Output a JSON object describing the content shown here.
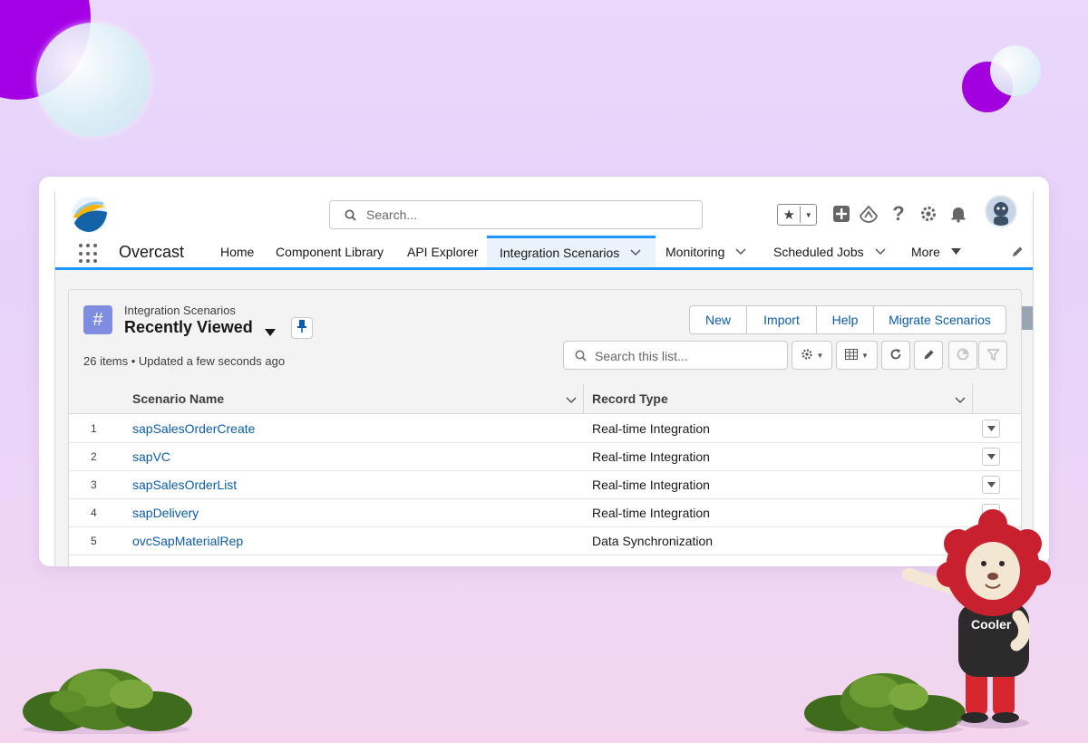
{
  "app": {
    "name": "Overcast",
    "search_placeholder": "Search..."
  },
  "nav": {
    "items": [
      {
        "label": "Home"
      },
      {
        "label": "Component Library"
      },
      {
        "label": "API Explorer"
      },
      {
        "label": "Integration Scenarios",
        "active": true
      },
      {
        "label": "Monitoring"
      },
      {
        "label": "Scheduled Jobs"
      },
      {
        "label": "More"
      }
    ]
  },
  "list_view": {
    "object_label": "Integration Scenarios",
    "view_name": "Recently Viewed",
    "meta": "26 items • Updated a few seconds ago",
    "buttons": [
      "New",
      "Import",
      "Help",
      "Migrate Scenarios"
    ],
    "search_placeholder": "Search this list...",
    "columns": [
      "Scenario Name",
      "Record Type"
    ],
    "rows": [
      {
        "num": "1",
        "name": "sapSalesOrderCreate",
        "type": "Real-time Integration"
      },
      {
        "num": "2",
        "name": "sapVC",
        "type": "Real-time Integration"
      },
      {
        "num": "3",
        "name": "sapSalesOrderList",
        "type": "Real-time Integration"
      },
      {
        "num": "4",
        "name": "sapDelivery",
        "type": "Real-time Integration"
      },
      {
        "num": "5",
        "name": "ovcSapMaterialRep",
        "type": "Data Synchronization"
      }
    ]
  },
  "mascot": {
    "shirt_text": "Cooler"
  },
  "colors": {
    "brand_blue": "#1b96ff",
    "link_blue": "#0b5cab",
    "object_icon": "#7f8de1",
    "accent_purple": "#a400e6"
  }
}
